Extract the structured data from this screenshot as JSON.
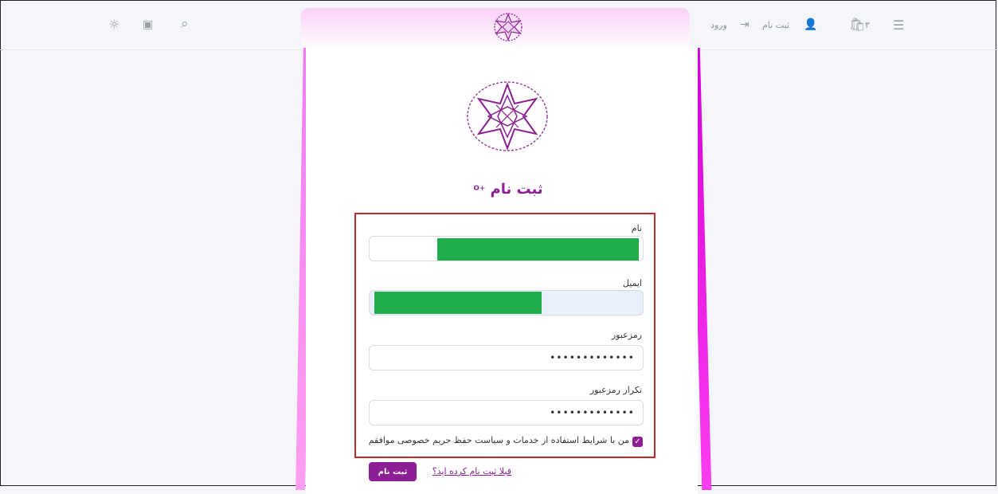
{
  "topbar": {
    "menu_icon": "menu-icon",
    "cart_count": "۳",
    "register_label": "ثبت نام",
    "login_label": "ورود",
    "icons": [
      "sun-icon",
      "book-icon",
      "search-icon"
    ]
  },
  "form": {
    "title": "ثبت نام",
    "name_label": "نام",
    "email_label": "ایمیل",
    "password_label": "رمزعبور",
    "password_value": "•••••••••••••",
    "confirm_label": "تکرار رمزعبور",
    "confirm_value": "•••••••••••••",
    "agree_text": "من با شرایط استفاده از خدمات و سیاست حفظ حریم خصوصی موافقم",
    "agree_checked": true,
    "submit_label": "ثبت نام",
    "already_link": "قبلا ثبت نام کرده اید؟"
  },
  "colors": {
    "brand": "#8b1f93",
    "highlight_box": "#c72929",
    "redaction": "#22ad4c"
  }
}
